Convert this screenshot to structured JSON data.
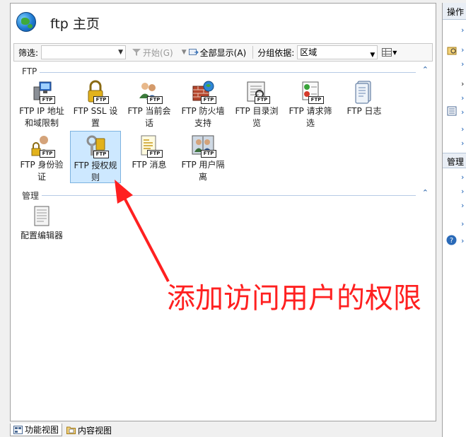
{
  "header": {
    "title": "ftp 主页"
  },
  "toolbar": {
    "filter_label": "筛选:",
    "start_label": "开始(G)",
    "show_all_label": "全部显示(A)",
    "groupby_label": "分组依据:",
    "groupby_value": "区域"
  },
  "groups": [
    {
      "label": "FTP",
      "features": [
        {
          "label": "FTP IP 地址和域限制",
          "icon": "ip-restrictions-icon"
        },
        {
          "label": "FTP SSL 设置",
          "icon": "ssl-lock-icon"
        },
        {
          "label": "FTP 当前会话",
          "icon": "sessions-icon"
        },
        {
          "label": "FTP 防火墙支持",
          "icon": "firewall-icon"
        },
        {
          "label": "FTP 目录浏览",
          "icon": "directory-browsing-icon"
        },
        {
          "label": "FTP 请求筛选",
          "icon": "request-filtering-icon"
        },
        {
          "label": "FTP 日志",
          "icon": "logging-icon"
        },
        {
          "label": "FTP 身份验证",
          "icon": "authentication-icon"
        },
        {
          "label": "FTP 授权规则",
          "icon": "authorization-rules-icon",
          "selected": true
        },
        {
          "label": "FTP 消息",
          "icon": "messages-icon"
        },
        {
          "label": "FTP 用户隔离",
          "icon": "user-isolation-icon"
        }
      ]
    },
    {
      "label": "管理",
      "features": [
        {
          "label": "配置编辑器",
          "icon": "configuration-editor-icon"
        }
      ]
    }
  ],
  "bottom_tabs": [
    {
      "label": "功能视图",
      "active": true
    },
    {
      "label": "内容视图",
      "active": false
    }
  ],
  "actions": {
    "title": "操作",
    "manage_title": "管理"
  },
  "annotation": {
    "text": "添加访问用户的权限"
  }
}
